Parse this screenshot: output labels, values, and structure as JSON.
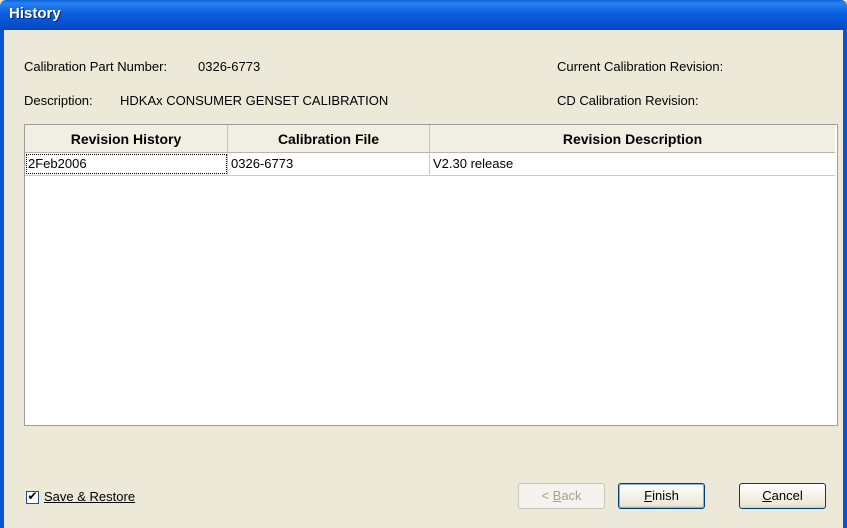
{
  "window": {
    "title": "History"
  },
  "header": {
    "part_number_label": "Calibration Part Number:",
    "part_number_value": "0326-6773",
    "description_label": "Description:",
    "description_value": "HDKAx CONSUMER GENSET CALIBRATION",
    "current_revision_label": "Current Calibration Revision:",
    "cd_revision_label": "CD Calibration Revision:"
  },
  "table": {
    "columns": [
      "Revision History",
      "Calibration File",
      "Revision Description"
    ],
    "rows": [
      [
        "2Feb2006",
        "0326-6773",
        "V2.30 release"
      ]
    ]
  },
  "footer": {
    "save_restore_label": "Save & Restore",
    "save_restore_checked": true,
    "back_label_prefix": "< ",
    "back_label_access": "B",
    "back_label_rest": "ack",
    "finish_label_access": "F",
    "finish_label_rest": "inish",
    "cancel_label_access": "C",
    "cancel_label_rest": "ancel"
  },
  "colors": {
    "titlebar": "#0b5ee0",
    "dialog_bg": "#ece9d8",
    "grid_bg": "#ffffff"
  },
  "icons": {
    "checkbox": "check-mark-icon"
  }
}
